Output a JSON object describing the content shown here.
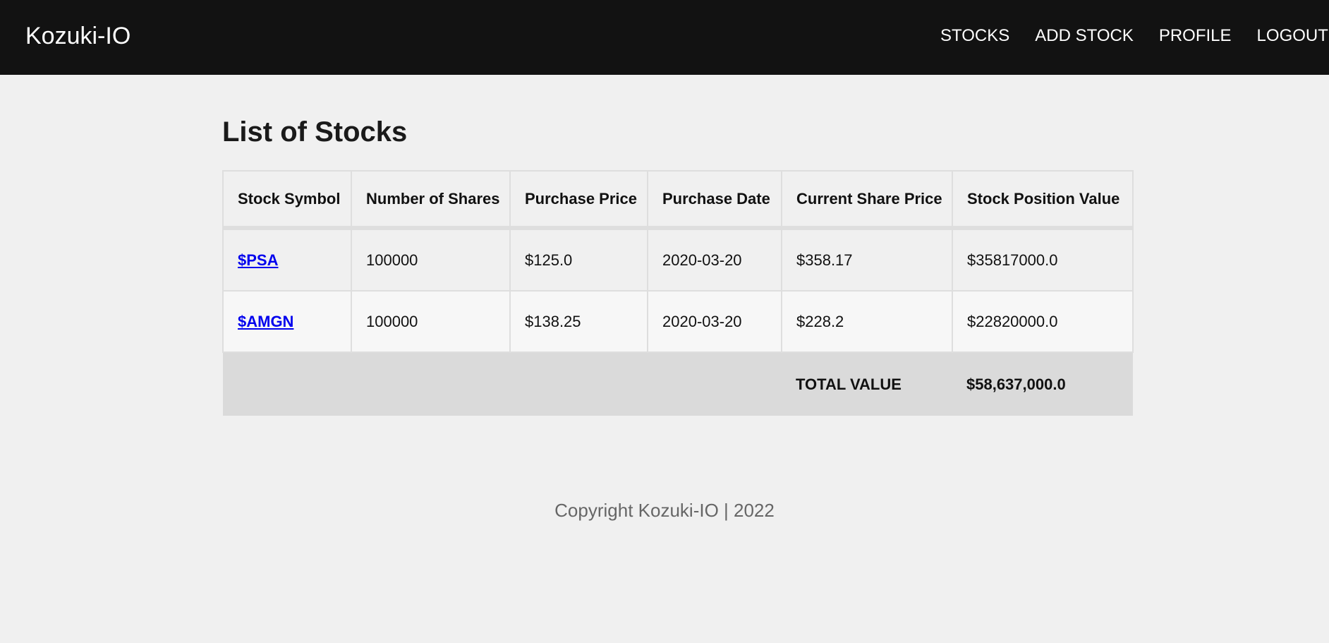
{
  "navbar": {
    "brand": "Kozuki-IO",
    "links": [
      "STOCKS",
      "ADD STOCK",
      "PROFILE",
      "LOGOUT"
    ]
  },
  "page": {
    "title": "List of Stocks"
  },
  "table": {
    "headers": [
      "Stock Symbol",
      "Number of Shares",
      "Purchase Price",
      "Purchase Date",
      "Current Share Price",
      "Stock Position Value"
    ],
    "rows": [
      [
        "$PSA",
        "100000",
        "$125.0",
        "2020-03-20",
        "$358.17",
        "$35817000.0"
      ],
      [
        "$AMGN",
        "100000",
        "$138.25",
        "2020-03-20",
        "$228.2",
        "$22820000.0"
      ]
    ],
    "total_label": "TOTAL VALUE",
    "total_value": "$58,637,000.0"
  },
  "footer": {
    "text": "Copyright Kozuki-IO | 2022"
  },
  "colors": {
    "navbar_bg": "#121212",
    "page_bg": "#f0f0f0",
    "link": "#0000ee",
    "total_row_bg": "#dadada"
  }
}
